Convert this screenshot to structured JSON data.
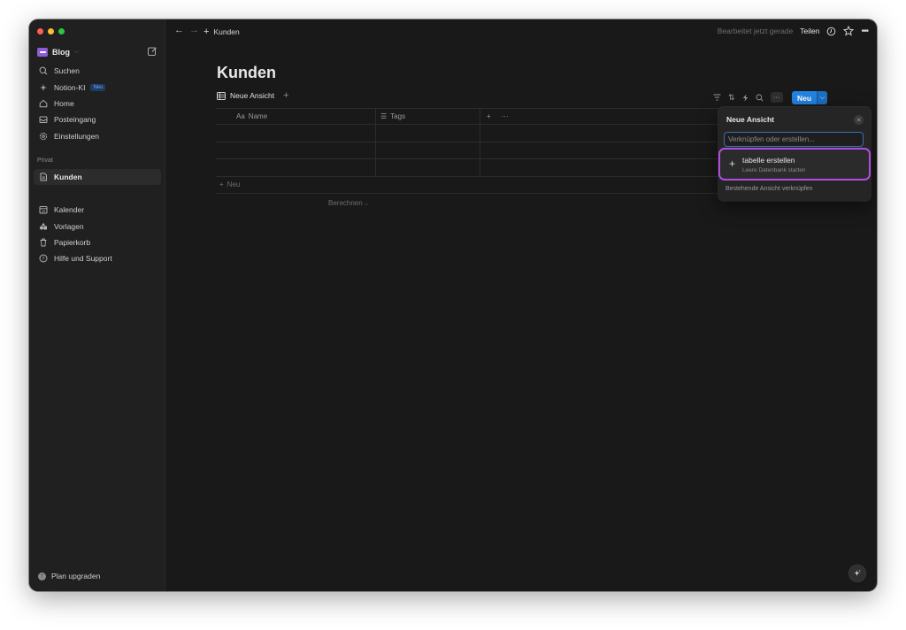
{
  "sidebar": {
    "workspace": "Blog",
    "items": [
      {
        "label": "Suchen",
        "icon": "search-icon"
      },
      {
        "label": "Notion-KI",
        "icon": "sparkle-icon",
        "badge": "Neu"
      },
      {
        "label": "Home",
        "icon": "home-icon"
      },
      {
        "label": "Posteingang",
        "icon": "inbox-icon"
      },
      {
        "label": "Einstellungen",
        "icon": "gear-icon"
      }
    ],
    "section_private": "Privat",
    "private_pages": [
      {
        "label": "Kunden",
        "icon": "page-icon",
        "active": true
      }
    ],
    "bottom_items": [
      {
        "label": "Kalender",
        "icon": "calendar-icon"
      },
      {
        "label": "Vorlagen",
        "icon": "templates-icon"
      },
      {
        "label": "Papierkorb",
        "icon": "trash-icon"
      },
      {
        "label": "Hilfe und Support",
        "icon": "help-icon"
      }
    ],
    "upgrade": "Plan upgraden"
  },
  "topbar": {
    "breadcrumb": "Kunden",
    "edited": "Bearbeitet jetzt gerade",
    "share": "Teilen"
  },
  "page": {
    "title": "Kunden",
    "view_tab": "Neue Ansicht",
    "new_button": "Neu",
    "table": {
      "columns": [
        {
          "prefix": "Aa",
          "label": "Name"
        },
        {
          "prefix": "☰",
          "label": "Tags"
        }
      ],
      "add_column": "+",
      "more": "···",
      "rows": 3,
      "new_row": "Neu",
      "calculate": "Berechnen"
    }
  },
  "popover": {
    "title": "Neue Ansicht",
    "input_placeholder": "Verknüpfen oder erstellen...",
    "option_title": "tabelle erstellen",
    "option_subtitle": "Leere Datenbank starten",
    "link_existing": "Bestehende Ansicht verknüpfen"
  },
  "colors": {
    "accent": "#2383e2",
    "highlight": "#b04ee0",
    "workspace_logo": "#8e5cd6"
  }
}
